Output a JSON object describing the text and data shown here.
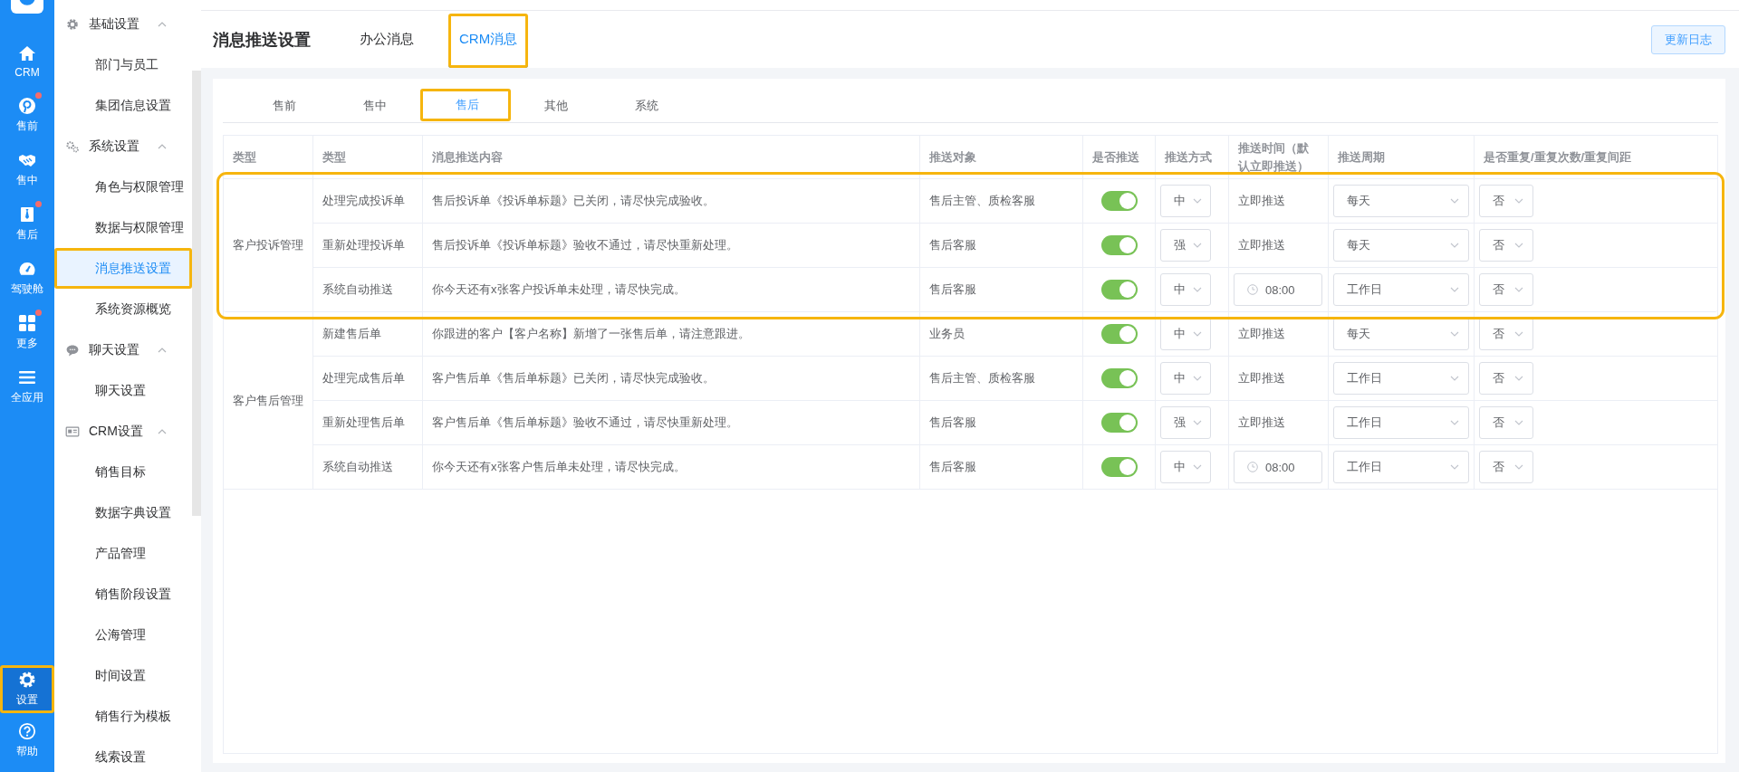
{
  "app_nav": {
    "items": [
      {
        "label": "CRM",
        "kind": "home",
        "badge": false,
        "selected": false,
        "highlighted": false
      },
      {
        "label": "售前",
        "kind": "pin",
        "badge": true,
        "selected": false,
        "highlighted": false
      },
      {
        "label": "售中",
        "kind": "handshake",
        "badge": false,
        "selected": false,
        "highlighted": false
      },
      {
        "label": "售后",
        "kind": "tie",
        "badge": true,
        "selected": false,
        "highlighted": false
      },
      {
        "label": "驾驶舱",
        "kind": "gauge",
        "badge": false,
        "selected": false,
        "highlighted": false
      },
      {
        "label": "更多",
        "kind": "grid",
        "badge": true,
        "selected": false,
        "highlighted": false
      },
      {
        "label": "全应用",
        "kind": "menu",
        "badge": false,
        "selected": false,
        "highlighted": false
      }
    ],
    "bottom_items": [
      {
        "label": "设置",
        "kind": "gear",
        "badge": false,
        "selected": true,
        "highlighted": true
      },
      {
        "label": "帮助",
        "kind": "help",
        "badge": false,
        "selected": false,
        "highlighted": false
      }
    ]
  },
  "settings_menu": {
    "groups": [
      {
        "label": "基础设置",
        "kind": "gear",
        "expanded": true,
        "items": [
          {
            "label": "部门与员工",
            "selected": false,
            "highlighted": false
          },
          {
            "label": "集团信息设置",
            "selected": false,
            "highlighted": false
          }
        ]
      },
      {
        "label": "系统设置",
        "kind": "gears",
        "expanded": true,
        "items": [
          {
            "label": "角色与权限管理",
            "selected": false,
            "highlighted": false
          },
          {
            "label": "数据与权限管理",
            "selected": false,
            "highlighted": false
          },
          {
            "label": "消息推送设置",
            "selected": true,
            "highlighted": true
          },
          {
            "label": "系统资源概览",
            "selected": false,
            "highlighted": false
          }
        ]
      },
      {
        "label": "聊天设置",
        "kind": "chat",
        "expanded": true,
        "items": [
          {
            "label": "聊天设置",
            "selected": false,
            "highlighted": false
          }
        ]
      },
      {
        "label": "CRM设置",
        "kind": "card",
        "expanded": true,
        "items": [
          {
            "label": "销售目标",
            "selected": false,
            "highlighted": false
          },
          {
            "label": "数据字典设置",
            "selected": false,
            "highlighted": false
          },
          {
            "label": "产品管理",
            "selected": false,
            "highlighted": false
          },
          {
            "label": "销售阶段设置",
            "selected": false,
            "highlighted": false
          },
          {
            "label": "公海管理",
            "selected": false,
            "highlighted": false
          },
          {
            "label": "时间设置",
            "selected": false,
            "highlighted": false
          },
          {
            "label": "销售行为模板",
            "selected": false,
            "highlighted": false
          },
          {
            "label": "线索设置",
            "selected": false,
            "highlighted": false
          }
        ]
      }
    ]
  },
  "header": {
    "title": "消息推送设置",
    "tabs": [
      {
        "label": "办公消息",
        "selected": false,
        "highlighted": false
      },
      {
        "label": "CRM消息",
        "selected": true,
        "highlighted": true
      }
    ],
    "button": "更新日志"
  },
  "sub_tabs": [
    {
      "label": "售前",
      "selected": false,
      "highlighted": false
    },
    {
      "label": "售中",
      "selected": false,
      "highlighted": false
    },
    {
      "label": "售后",
      "selected": true,
      "highlighted": true
    },
    {
      "label": "其他",
      "selected": false,
      "highlighted": false
    },
    {
      "label": "系统",
      "selected": false,
      "highlighted": false
    }
  ],
  "table": {
    "columns": [
      "类型",
      "类型",
      "消息推送内容",
      "推送对象",
      "是否推送",
      "推送方式",
      "推送时间（默认立即推送）",
      "推送周期",
      "是否重复/重复次数/重复间距"
    ],
    "groups": [
      {
        "category": "客户投诉管理",
        "highlighted": true,
        "rows": [
          {
            "type": "处理完成投诉单",
            "content": "售后投诉单《投诉单标题》已关闭，请尽快完成验收。",
            "recipients": "售后主管、质检客服",
            "push_enabled": true,
            "mode": "中",
            "time": {
              "kind": "text",
              "value": "立即推送"
            },
            "cycle": "每天",
            "repeat": "否"
          },
          {
            "type": "重新处理投诉单",
            "content": "售后投诉单《投诉单标题》验收不通过，请尽快重新处理。",
            "recipients": "售后客服",
            "push_enabled": true,
            "mode": "强",
            "time": {
              "kind": "text",
              "value": "立即推送"
            },
            "cycle": "每天",
            "repeat": "否"
          },
          {
            "type": "系统自动推送",
            "content": "你今天还有x张客户投诉单未处理，请尽快完成。",
            "recipients": "售后客服",
            "push_enabled": true,
            "mode": "中",
            "time": {
              "kind": "picker",
              "value": "08:00"
            },
            "cycle": "工作日",
            "repeat": "否"
          }
        ]
      },
      {
        "category": "客户售后管理",
        "highlighted": false,
        "rows": [
          {
            "type": "新建售后单",
            "content": "你跟进的客户【客户名称】新增了一张售后单，请注意跟进。",
            "recipients": "业务员",
            "push_enabled": true,
            "mode": "中",
            "time": {
              "kind": "text",
              "value": "立即推送"
            },
            "cycle": "每天",
            "repeat": "否"
          },
          {
            "type": "处理完成售后单",
            "content": "客户售后单《售后单标题》已关闭，请尽快完成验收。",
            "recipients": "售后主管、质检客服",
            "push_enabled": true,
            "mode": "中",
            "time": {
              "kind": "text",
              "value": "立即推送"
            },
            "cycle": "工作日",
            "repeat": "否"
          },
          {
            "type": "重新处理售后单",
            "content": "客户售后单《售后单标题》验收不通过，请尽快重新处理。",
            "recipients": "售后客服",
            "push_enabled": true,
            "mode": "强",
            "time": {
              "kind": "text",
              "value": "立即推送"
            },
            "cycle": "工作日",
            "repeat": "否"
          },
          {
            "type": "系统自动推送",
            "content": "你今天还有x张客户售后单未处理，请尽快完成。",
            "recipients": "售后客服",
            "push_enabled": true,
            "mode": "中",
            "time": {
              "kind": "picker",
              "value": "08:00"
            },
            "cycle": "工作日",
            "repeat": "否"
          }
        ]
      }
    ]
  }
}
